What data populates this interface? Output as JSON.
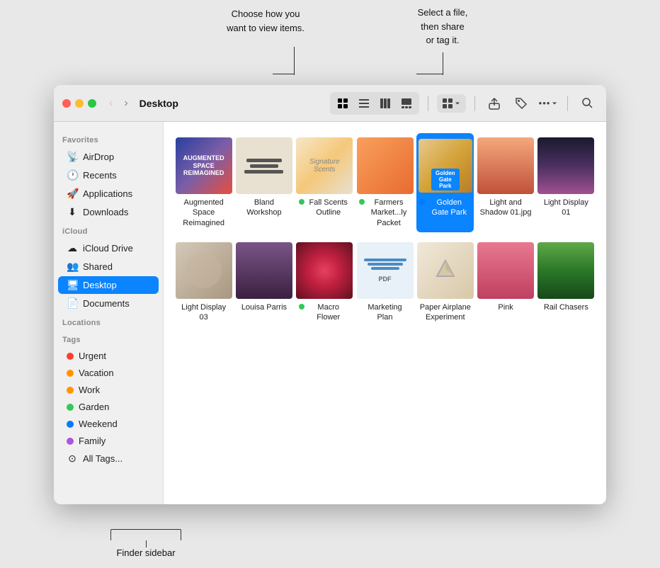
{
  "callouts": {
    "view_items": "Choose how you\nwant to view items.",
    "select_share": "Select a file,\nthen share\nor tag it.",
    "finder_sidebar": "Finder sidebar"
  },
  "window": {
    "title": "Desktop"
  },
  "toolbar": {
    "back_label": "‹",
    "forward_label": "›",
    "view_icons": "⊞",
    "view_list": "≡",
    "view_columns": "⊟",
    "view_gallery": "⊡",
    "group_label": "⊞⊟",
    "share_icon": "↑",
    "tag_icon": "🏷",
    "more_icon": "•••",
    "search_icon": "⌕"
  },
  "sidebar": {
    "favorites_label": "Favorites",
    "items_favorites": [
      {
        "icon": "airdrop",
        "label": "AirDrop"
      },
      {
        "icon": "recents",
        "label": "Recents"
      },
      {
        "icon": "applications",
        "label": "Applications"
      },
      {
        "icon": "downloads",
        "label": "Downloads"
      }
    ],
    "icloud_label": "iCloud",
    "items_icloud": [
      {
        "icon": "icloud",
        "label": "iCloud Drive"
      },
      {
        "icon": "shared",
        "label": "Shared"
      },
      {
        "icon": "desktop",
        "label": "Desktop",
        "active": true
      },
      {
        "icon": "documents",
        "label": "Documents"
      }
    ],
    "locations_label": "Locations",
    "tags_label": "Tags",
    "tags": [
      {
        "color": "#ff3b30",
        "label": "Urgent"
      },
      {
        "color": "#ff9500",
        "label": "Vacation"
      },
      {
        "color": "#ff9500",
        "label": "Work"
      },
      {
        "color": "#34c759",
        "label": "Garden"
      },
      {
        "color": "#007aff",
        "label": "Weekend"
      },
      {
        "color": "#af52de",
        "label": "Family"
      },
      {
        "color": "#aaa",
        "label": "All Tags..."
      }
    ]
  },
  "files": [
    {
      "id": "augmented",
      "name": "Augmented\nSpace Reimagined",
      "dot": null
    },
    {
      "id": "bland",
      "name": "Bland Workshop",
      "dot": null
    },
    {
      "id": "fall",
      "name": "Fall Scents\nOutline",
      "dot": "#34c759"
    },
    {
      "id": "farmers",
      "name": "Farmers\nMarket...ly Packet",
      "dot": "#34c759"
    },
    {
      "id": "golden",
      "name": "Golden Gate\nPark",
      "dot": "#007aff",
      "selected": true
    },
    {
      "id": "light-shadow",
      "name": "Light and Shadow\n01.jpg",
      "dot": null
    },
    {
      "id": "light01",
      "name": "Light Display 01",
      "dot": null
    },
    {
      "id": "light03",
      "name": "Light Display 03",
      "dot": null
    },
    {
      "id": "louisa",
      "name": "Louisa Parris",
      "dot": null
    },
    {
      "id": "macro",
      "name": "Macro Flower",
      "dot": "#34c759"
    },
    {
      "id": "marketing",
      "name": "Marketing Plan",
      "dot": null
    },
    {
      "id": "paper",
      "name": "Paper Airplane\nExperiment",
      "dot": null
    },
    {
      "id": "pink",
      "name": "Pink",
      "dot": null
    },
    {
      "id": "rail",
      "name": "Rail Chasers",
      "dot": null
    }
  ]
}
